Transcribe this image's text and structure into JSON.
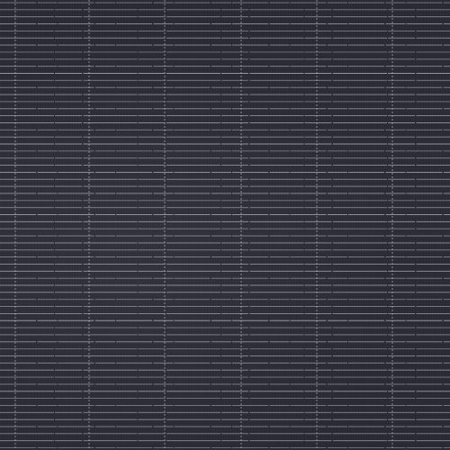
{
  "image": {
    "subject": "solar-panel-cell-surface",
    "colors": {
      "background": "#2b2b35",
      "finger_line": "#b9bcc6",
      "busbar": "#c9ccd4"
    }
  }
}
